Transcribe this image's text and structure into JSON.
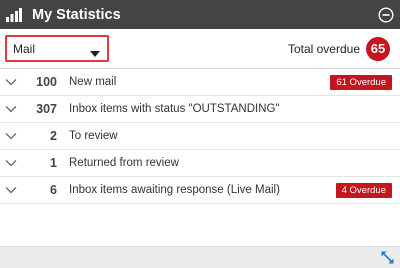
{
  "header": {
    "title": "My Statistics",
    "icon": "bar-chart-icon",
    "collapse_icon": "minus-circle-icon"
  },
  "toolbar": {
    "selected_source": "Mail",
    "total_label": "Total overdue",
    "total_count": "65"
  },
  "rows": [
    {
      "count": "100",
      "label": "New mail",
      "badge": "61 Overdue"
    },
    {
      "count": "307",
      "label": "Inbox items with status \"OUTSTANDING\"",
      "badge": ""
    },
    {
      "count": "2",
      "label": "To review",
      "badge": ""
    },
    {
      "count": "1",
      "label": "Returned from review",
      "badge": ""
    },
    {
      "count": "6",
      "label": "Inbox items awaiting response (Live Mail)",
      "badge": "4 Overdue"
    }
  ],
  "footer": {
    "expand_icon": "expand-icon"
  },
  "colors": {
    "header_bg": "#444444",
    "accent_red": "#c4161c",
    "select_border": "#e0393e",
    "accent_blue": "#1a7ad9"
  }
}
